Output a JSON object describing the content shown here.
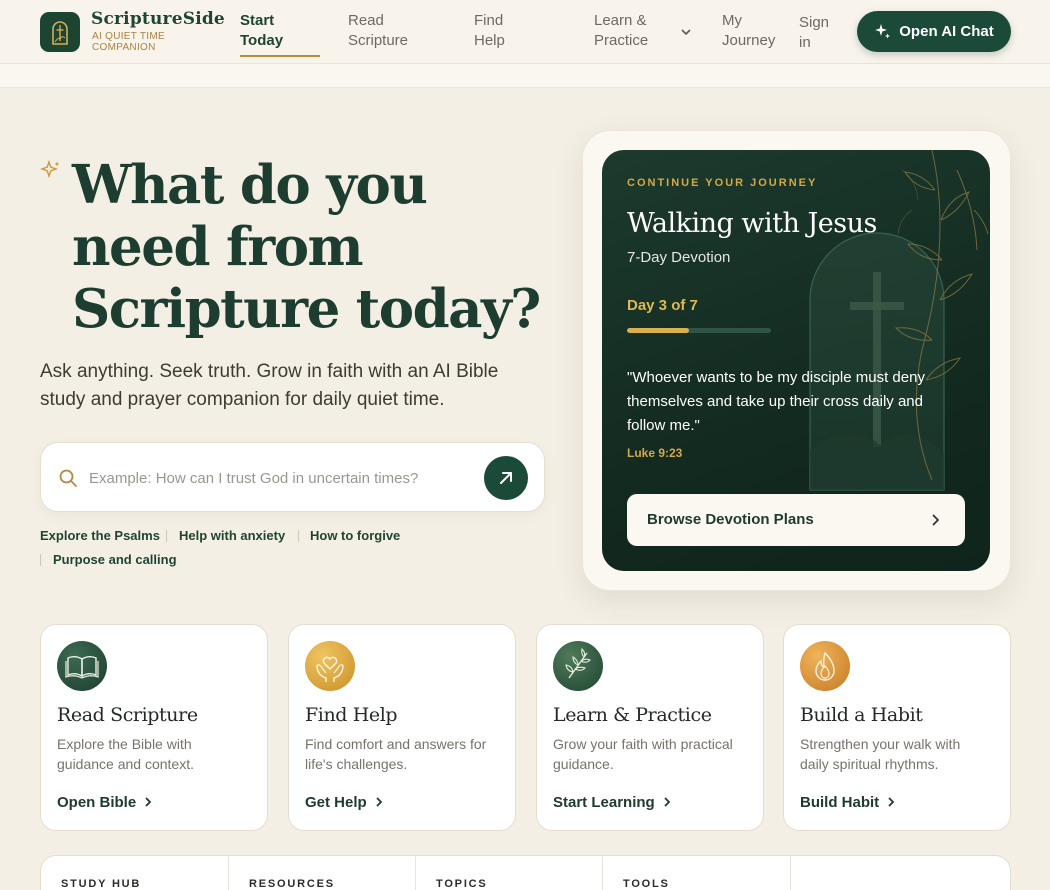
{
  "brand": {
    "name": "ScriptureSide",
    "tagline": "AI QUIET TIME COMPANION"
  },
  "nav": {
    "start_today": "Start Today",
    "read_scripture": "Read Scripture",
    "find_help": "Find Help",
    "learn_practice": "Learn & Practice",
    "my_journey": "My Journey",
    "sign_in": "Sign in",
    "open_chat": "Open AI Chat"
  },
  "hero": {
    "title": "What do you need from Scripture today?",
    "subtitle": "Ask anything. Seek truth. Grow in faith with an AI Bible study and prayer companion for daily quiet time."
  },
  "search": {
    "placeholder": "Example: How can I trust God in uncertain times?",
    "value": ""
  },
  "suggestions": [
    "Explore the Psalms",
    "Help with anxiety",
    "How to forgive",
    "Purpose and calling"
  ],
  "journey": {
    "eyebrow": "CONTINUE YOUR JOURNEY",
    "title": "Walking with Jesus",
    "subtitle": "7-Day Devotion",
    "day": "Day 3 of 7",
    "progress": 0.43,
    "quote": "\"Whoever wants to be my disciple must deny themselves and take up their cross daily and follow me.\"",
    "reference": "Luke 9:23",
    "button": "Browse Devotion Plans"
  },
  "cards": [
    {
      "title": "Read Scripture",
      "desc": "Explore the Bible with guidance and context.",
      "link": "Open Bible",
      "icon": "open-book-icon"
    },
    {
      "title": "Find Help",
      "desc": "Find comfort and answers for life's challenges.",
      "link": "Get Help",
      "icon": "heart-hands-icon"
    },
    {
      "title": "Learn & Practice",
      "desc": "Grow your faith with practical guidance.",
      "link": "Start Learning",
      "icon": "olive-branch-icon"
    },
    {
      "title": "Build a Habit",
      "desc": "Strengthen your walk with daily spiritual rhythms.",
      "link": "Build Habit",
      "icon": "flame-icon"
    }
  ],
  "bottom": {
    "study_hub": "STUDY HUB",
    "resources": "RESOURCES",
    "topics": "TOPICS",
    "tools": "TOOLS"
  },
  "colors": {
    "primary": "#1b4a39",
    "gold": "#d3a848",
    "background": "#f4efe5"
  }
}
